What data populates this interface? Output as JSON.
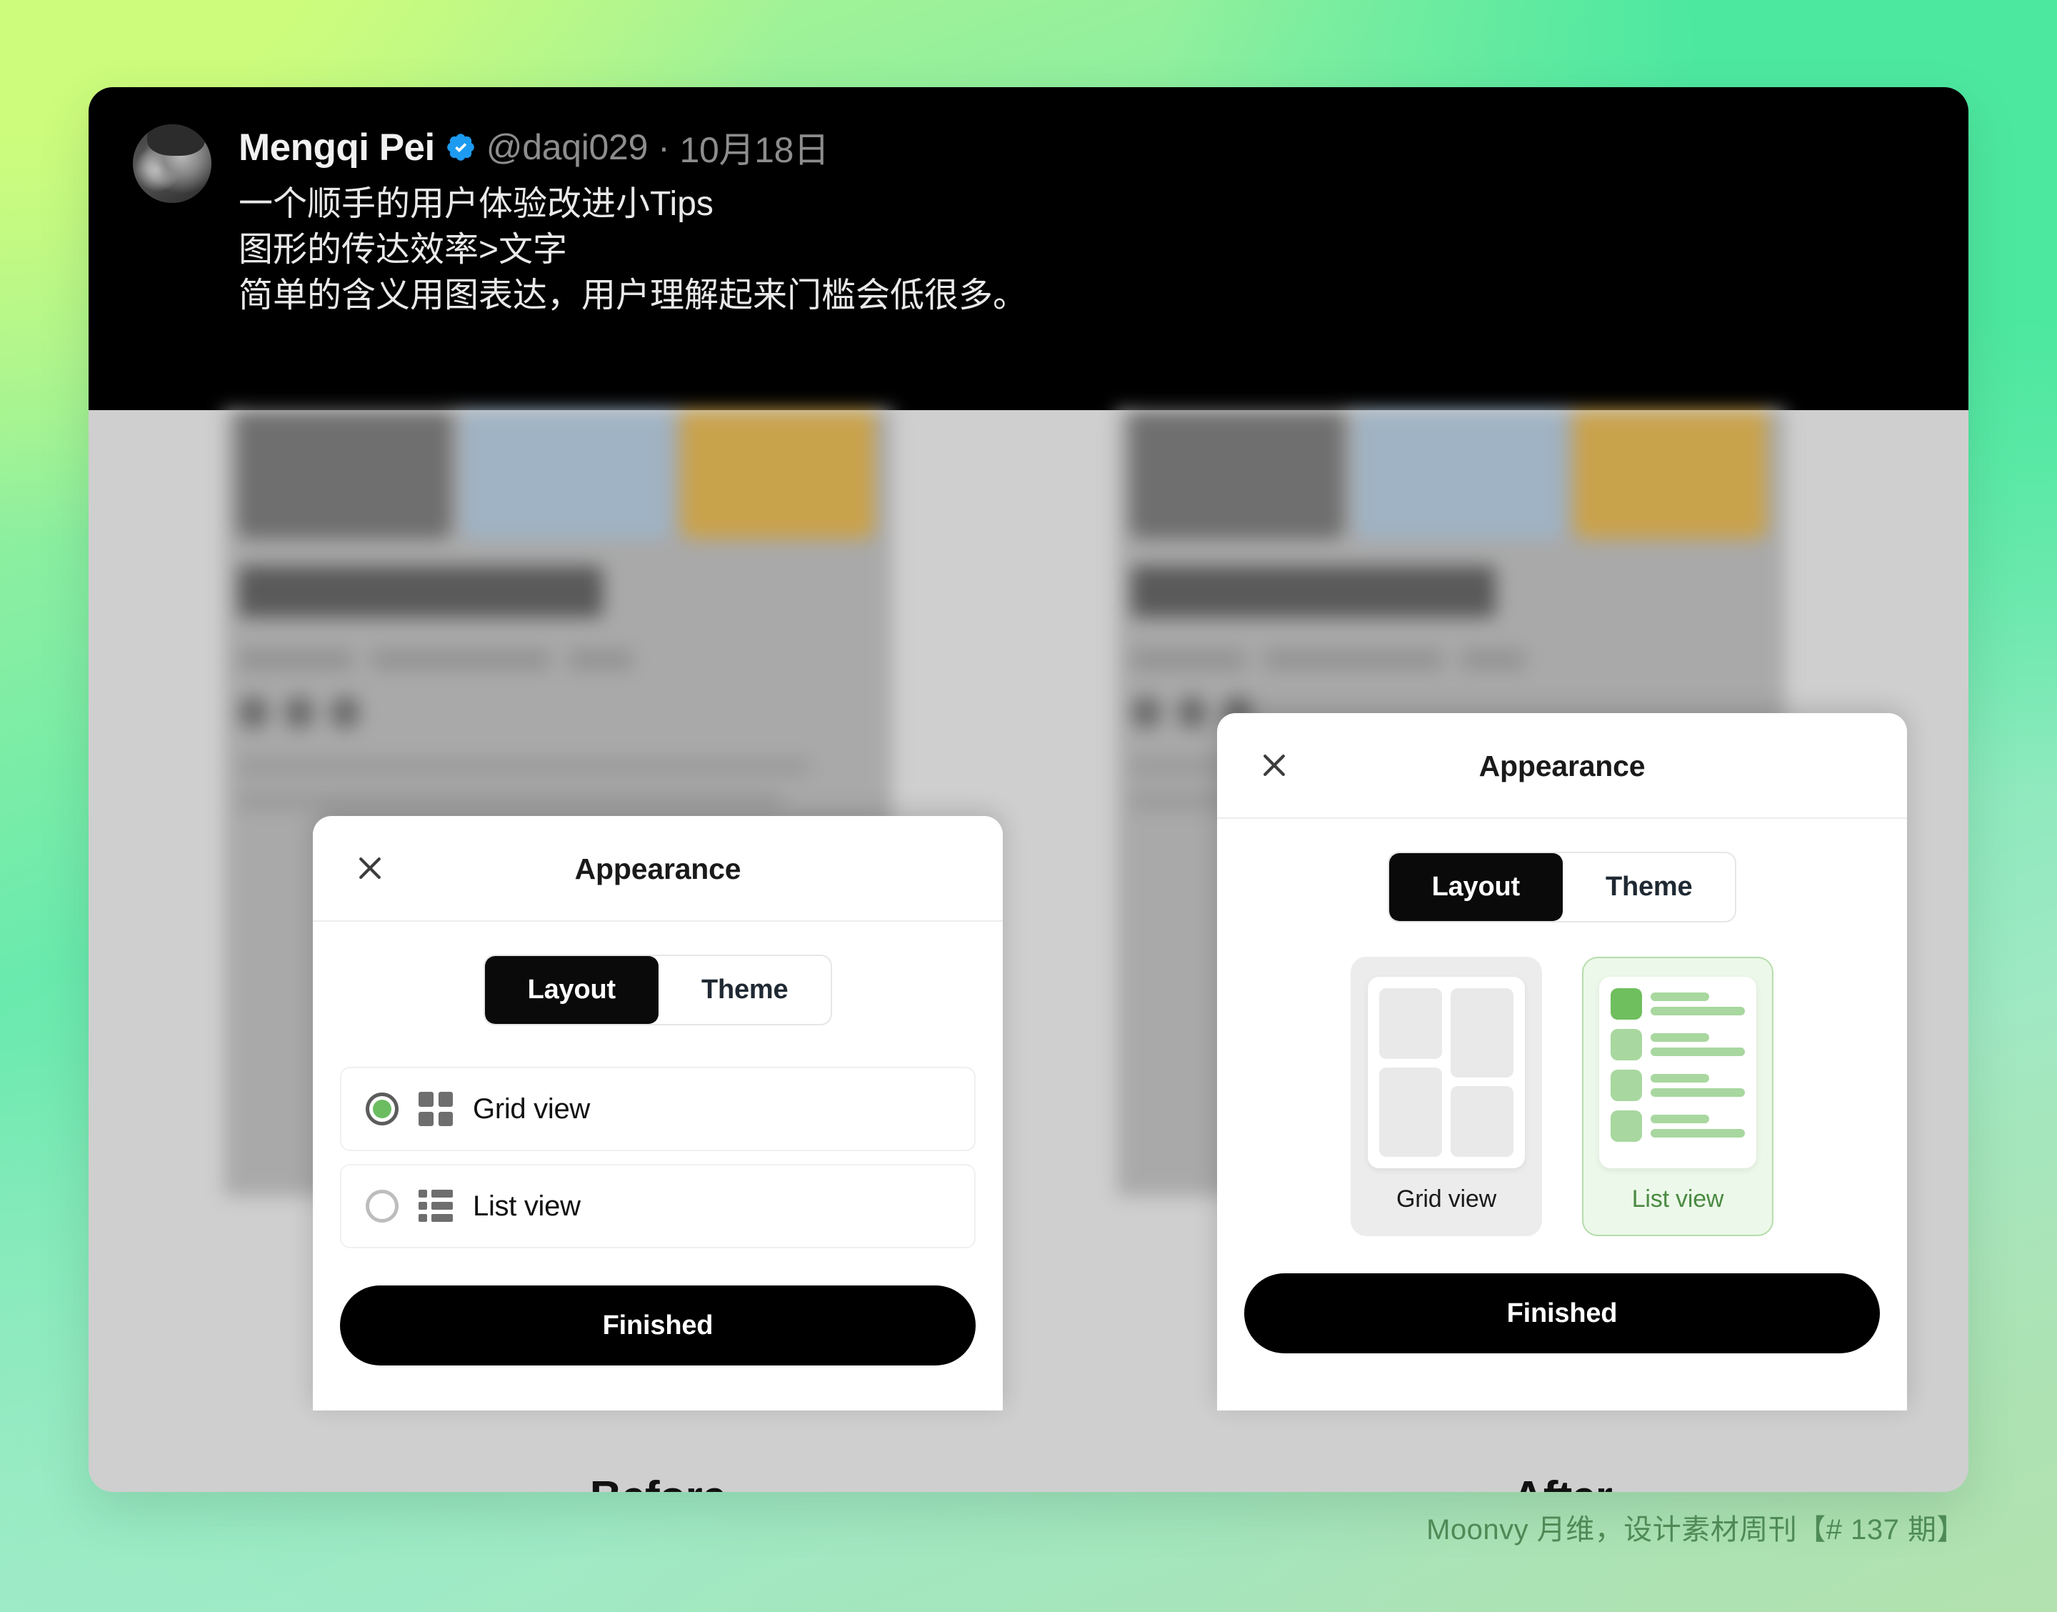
{
  "tweet": {
    "author_name": "Mengqi Pei",
    "verified_icon": "verified-badge-icon",
    "handle": "@daqi029",
    "separator": "·",
    "date": "10月18日",
    "line1": "一个顺手的用户体验改进小Tips",
    "line2": "图形的传达效率>文字",
    "line3": "简单的含义用图表达，用户理解起来门槛会低很多。"
  },
  "before": {
    "caption": "Before",
    "sheet": {
      "close_icon": "close-icon",
      "title": "Appearance",
      "tabs": [
        {
          "label": "Layout",
          "active": true
        },
        {
          "label": "Theme",
          "active": false
        }
      ],
      "options": [
        {
          "label": "Grid view",
          "icon": "grid-icon",
          "selected": true
        },
        {
          "label": "List view",
          "icon": "list-icon",
          "selected": false
        }
      ],
      "primary_button": "Finished"
    }
  },
  "after": {
    "caption": "After",
    "sheet": {
      "close_icon": "close-icon",
      "title": "Appearance",
      "tabs": [
        {
          "label": "Layout",
          "active": true
        },
        {
          "label": "Theme",
          "active": false
        }
      ],
      "cards": [
        {
          "label": "Grid view",
          "preview": "grid-masonry-preview",
          "selected": false
        },
        {
          "label": "List view",
          "preview": "list-rows-preview",
          "selected": true
        }
      ],
      "primary_button": "Finished"
    }
  },
  "footer": {
    "text": "Moonvy 月维，设计素材周刊【# 137 期】"
  },
  "colors": {
    "accent_green": "#6cbd62",
    "selected_card_bg": "#ecf8e9",
    "selected_card_border": "#b4ddab",
    "selected_label": "#4a8a42",
    "panel_bg": "#cfcfcf",
    "tweet_bg": "#000000",
    "button_bg": "#000000",
    "verified_blue": "#1d9bf0",
    "footer_text": "#4e8a56"
  }
}
